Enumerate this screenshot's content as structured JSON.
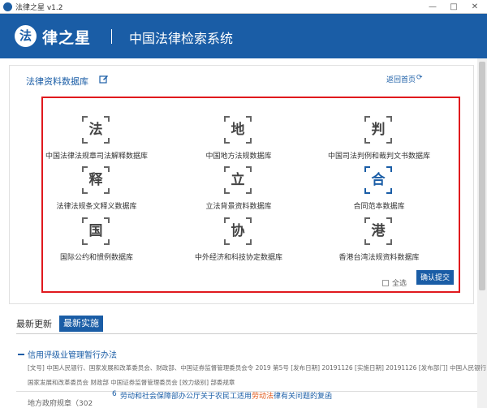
{
  "window": {
    "title": "法律之星 v1.2",
    "controls": [
      "—",
      "□",
      "✕"
    ]
  },
  "header": {
    "logo_char": "法",
    "brand": "律之星",
    "system_title": "中国法律检索系统"
  },
  "section": {
    "title": "法律资料数据库",
    "back_home": "返回首页",
    "back_icon": "⟳"
  },
  "databases": [
    {
      "char": "法",
      "label": "中国法律法规章司法解释数据库"
    },
    {
      "char": "地",
      "label": "中国地方法规数据库"
    },
    {
      "char": "判",
      "label": "中国司法判例和裁判文书数据库"
    },
    {
      "char": "释",
      "label": "法律法规条文释义数据库"
    },
    {
      "char": "立",
      "label": "立法背景资料数据库"
    },
    {
      "char": "合",
      "label": "合同范本数据库"
    },
    {
      "char": "国",
      "label": "国际公约和惯例数据库"
    },
    {
      "char": "协",
      "label": "中外经济和科技协定数据库"
    },
    {
      "char": "港",
      "label": "香港台湾法规资料数据库"
    }
  ],
  "select_all": "全选",
  "confirm": "确认提交",
  "tabs": {
    "latest": "最新更新",
    "effective": "最新实施"
  },
  "article": {
    "title": "信用评级业管理暂行办法",
    "meta_line1": "[文号] 中国人民银行、国家发展和改革委员会、财政部、中国证券监督管理委员会令 2019 第5号  [发布日期] 20191126  [实施日期] 20191126  [发布部门] 中国人民银行",
    "meta_line2": "国家发展和改革委员会 财政部 中国证券监督管理委员会  [效力级别] 部委规章"
  },
  "bottom": {
    "local_rules": "地方政府规章（302",
    "news_bullet": "6",
    "news_pre": "劳动和社会保障部办公厅关于农民工适用",
    "news_hl": "劳动法",
    "news_post": "律有关问题的复函"
  },
  "colors": {
    "primary": "#1a5da6",
    "highlight_box": "#e0191e",
    "accent_text": "#e05a1c"
  }
}
